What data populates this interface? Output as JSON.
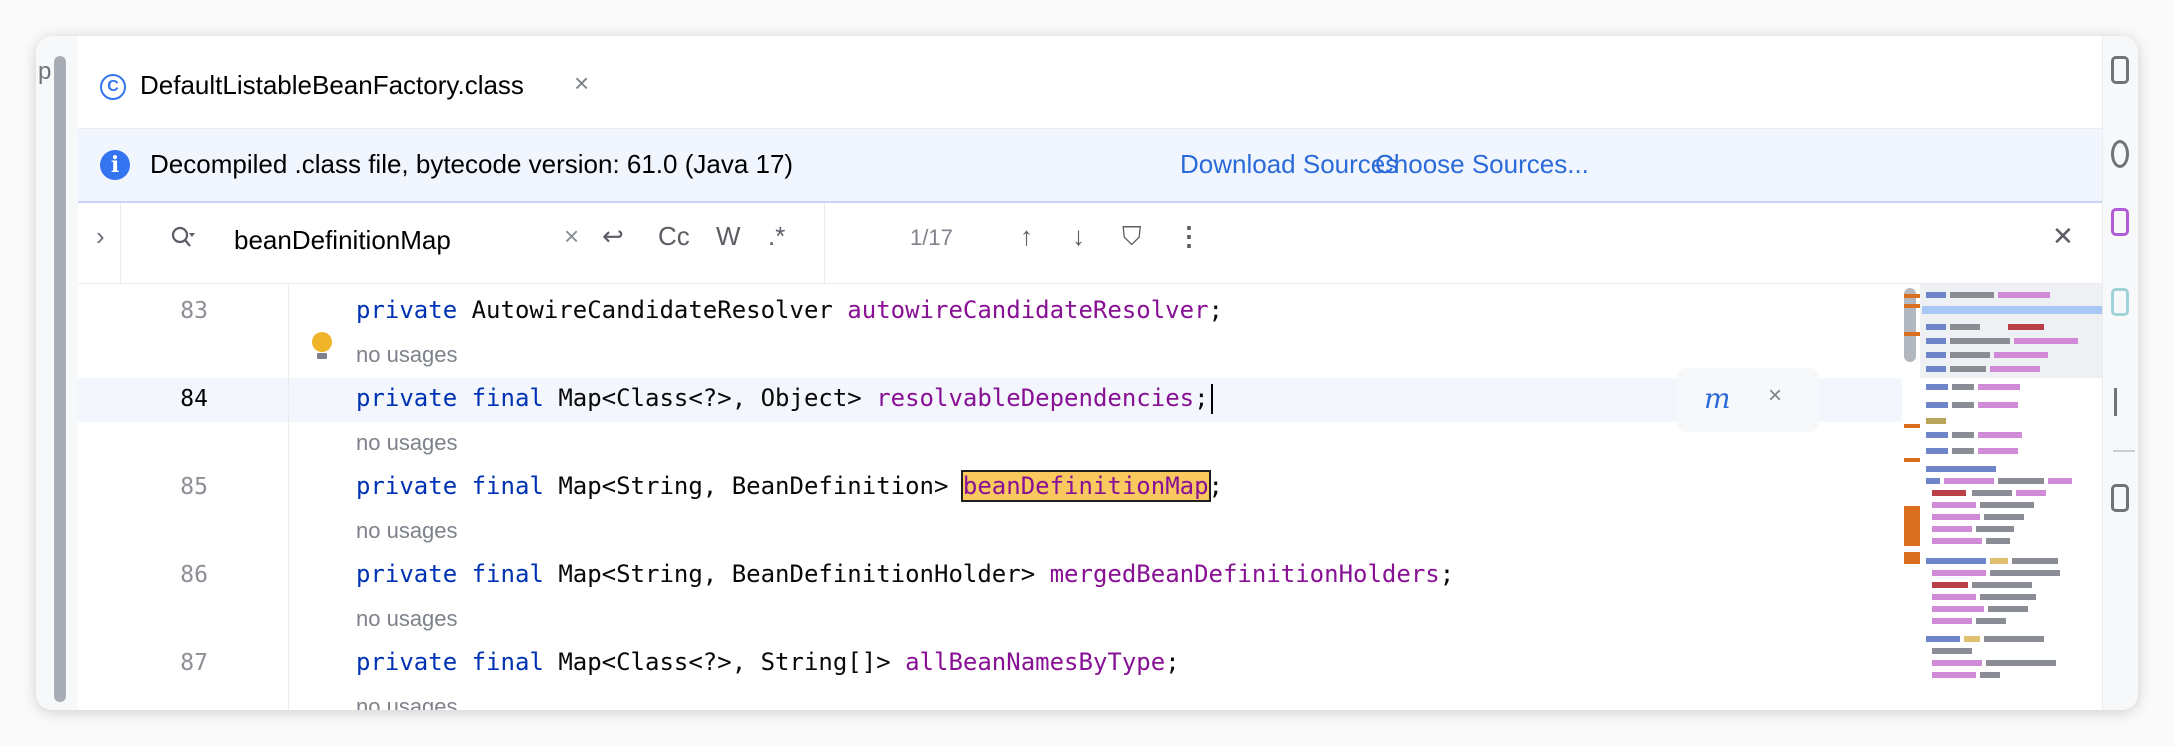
{
  "left_strip": {
    "fragment": "p"
  },
  "tab": {
    "icon": "C",
    "label": "DefaultListableBeanFactory.class",
    "close": "×"
  },
  "banner": {
    "icon": "i",
    "message": "Decompiled .class file, bytecode version: 61.0 (Java 17)",
    "download_sources": "Download Sources",
    "choose_sources": "Choose Sources..."
  },
  "find": {
    "expand": "›",
    "query": "beanDefinitionMap",
    "clear": "×",
    "newline": "↩",
    "match_case": "Cc",
    "words": "W",
    "regex": ".*",
    "count": "1/17",
    "prev": "↑",
    "next": "↓",
    "filter": "⛉",
    "more": "⋮",
    "close": "✕"
  },
  "code": {
    "lines": [
      {
        "num": "83",
        "kw": "private",
        "kw2": "",
        "type": "AutowireCandidateResolver",
        "field": "autowireCandidateResolver",
        "end": ";",
        "usage": "no usages"
      },
      {
        "num": "84",
        "kw": "private",
        "kw2": "final",
        "type": "Map<Class<?>, Object>",
        "field": "resolvableDependencies",
        "end": ";",
        "usage": "no usages"
      },
      {
        "num": "85",
        "kw": "private",
        "kw2": "final",
        "type": "Map<String, BeanDefinition>",
        "field": "beanDefinitionMap",
        "end": ";",
        "usage": "no usages"
      },
      {
        "num": "86",
        "kw": "private",
        "kw2": "final",
        "type": "Map<String, BeanDefinitionHolder>",
        "field": "mergedBeanDefinitionHolders",
        "end": ";",
        "usage": "no usages"
      },
      {
        "num": "87",
        "kw": "private",
        "kw2": "final",
        "type": "Map<Class<?>, String[]>",
        "field": "allBeanNamesByType",
        "end": ";",
        "usage": "no usages"
      }
    ]
  },
  "inline_tools": {
    "reader_mode": "m",
    "close": "×"
  },
  "colors": {
    "accent": "#3574f0",
    "keyword": "#0033b3",
    "field": "#871094",
    "match": "#f9c95f",
    "link": "#2a6bd9"
  }
}
